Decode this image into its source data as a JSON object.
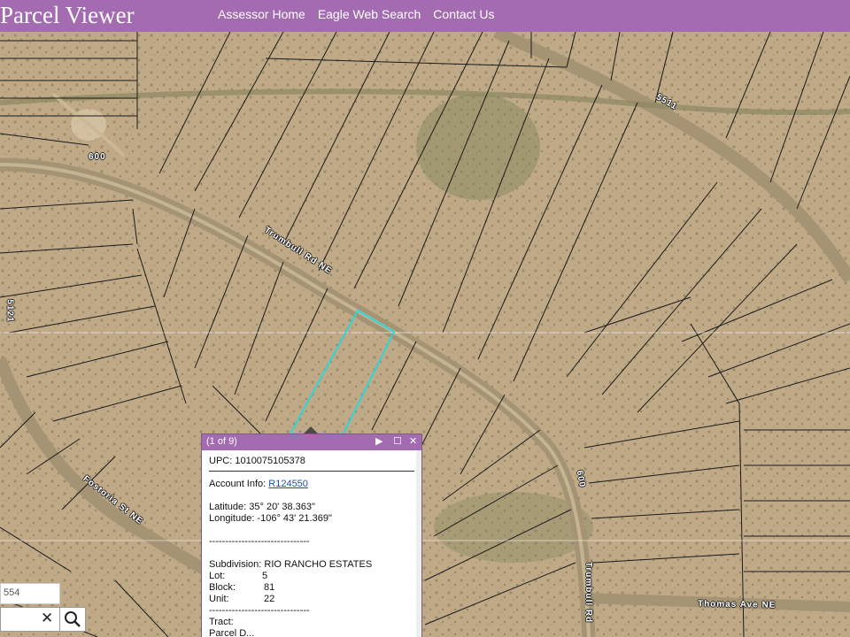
{
  "header": {
    "title": "Parcel Viewer",
    "nav": [
      "Assessor Home",
      "Eagle Web Search",
      "Contact Us"
    ]
  },
  "map": {
    "road_labels": {
      "trumbull_upper": "Trumbull Rd NE",
      "trumbull_lower": "Trumbull Rd",
      "fostoria": "Fostoria St NE",
      "thomas": "Thomas Ave NE",
      "n600_a": "600",
      "n600_b": "600",
      "n5511": "5511",
      "n5121": "5121"
    },
    "colors": {
      "header": "#a36bb0",
      "parcel_highlight": "#2fd6d6",
      "terrain": "#bfa987"
    }
  },
  "popup": {
    "counter": "(1 of 9)",
    "icons": [
      "next-icon",
      "maximize-icon",
      "close-icon"
    ],
    "upc": "UPC: 1010075105378",
    "account_label": "Account Info: ",
    "account_link": "R124550",
    "latitude": "Latitude: 35° 20' 38.363\"",
    "longitude": "Longitude: -106° 43' 21.369\"",
    "divider": "-------------------------------",
    "subdivision": "Subdivision: RIO RANCHO ESTATES",
    "lot_label": "Lot:",
    "lot_value": "5",
    "block_label": "Block:",
    "block_value": "81",
    "unit_label": "Unit:",
    "unit_value": "22",
    "tract": "Tract:",
    "parcel_d": "Parcel D..."
  },
  "search": {
    "value_top": "554",
    "clear_icon": "clear-icon",
    "search_icon": "search-icon"
  }
}
